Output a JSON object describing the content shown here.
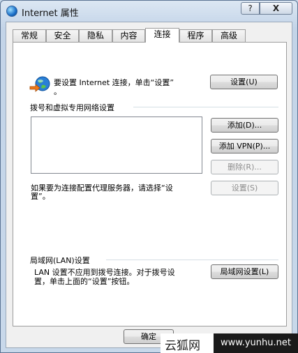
{
  "window": {
    "title": "Internet 属性",
    "help_label": "?",
    "close_label": "X"
  },
  "tabs": [
    "常规",
    "安全",
    "隐私",
    "内容",
    "连接",
    "程序",
    "高级"
  ],
  "active_tab": 4,
  "setup": {
    "text_line1": "要设置 Internet 连接，单击“设置”",
    "text_line2": "。",
    "button": "设置(U)"
  },
  "dialup": {
    "heading": "拨号和虚拟专用网络设置",
    "add_button": "添加(D)...",
    "add_vpn_button": "添加 VPN(P)...",
    "remove_button": "删除(R)...",
    "proxy_text_line1": "如果要为连接配置代理服务器，请选择“设",
    "proxy_text_line2": "置”。",
    "settings_button": "设置(S)"
  },
  "lan": {
    "heading": "局域网(LAN)设置",
    "text_line1": "LAN 设置不应用到拨号连接。对于拨号设",
    "text_line2": "置，单击上面的“设置”按钮。",
    "button": "局域网设置(L)"
  },
  "footer": {
    "ok_button": "确定"
  },
  "watermark": {
    "name": "云狐网",
    "url": "www.yunhu.net"
  }
}
